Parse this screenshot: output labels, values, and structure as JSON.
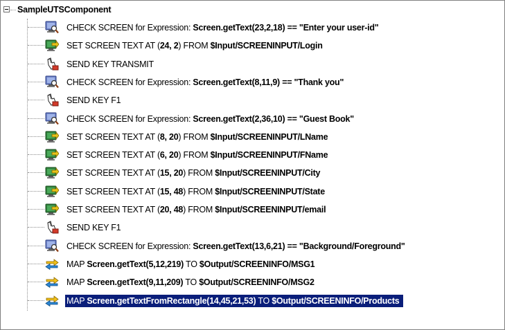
{
  "tree": {
    "root_label": "SampleUTSComponent",
    "items": [
      {
        "icon": "check-screen-icon",
        "prefix": "CHECK SCREEN for Expression: ",
        "bold": "Screen.getText(23,2,18) == \"Enter your user-id\"",
        "suffix": "",
        "mid": "",
        "bold2": ""
      },
      {
        "icon": "set-screen-text-icon",
        "prefix": "SET SCREEN TEXT AT (",
        "bold": "24, 2",
        "mid": ") FROM ",
        "bold2": "$Input/SCREENINPUT/Login",
        "suffix": ""
      },
      {
        "icon": "send-key-icon",
        "prefix": "SEND KEY TRANSMIT",
        "bold": "",
        "mid": "",
        "bold2": "",
        "suffix": ""
      },
      {
        "icon": "check-screen-icon",
        "prefix": "CHECK SCREEN for Expression: ",
        "bold": "Screen.getText(8,11,9) == \"Thank you\"",
        "mid": "",
        "bold2": "",
        "suffix": ""
      },
      {
        "icon": "send-key-icon",
        "prefix": "SEND KEY F1",
        "bold": "",
        "mid": "",
        "bold2": "",
        "suffix": ""
      },
      {
        "icon": "check-screen-icon",
        "prefix": "CHECK SCREEN for Expression: ",
        "bold": "Screen.getText(2,36,10) == \"Guest Book\"",
        "mid": "",
        "bold2": "",
        "suffix": ""
      },
      {
        "icon": "set-screen-text-icon",
        "prefix": "SET SCREEN TEXT AT (",
        "bold": "8, 20",
        "mid": ") FROM ",
        "bold2": "$Input/SCREENINPUT/LName",
        "suffix": ""
      },
      {
        "icon": "set-screen-text-icon",
        "prefix": "SET SCREEN TEXT AT (",
        "bold": "6, 20",
        "mid": ") FROM ",
        "bold2": "$Input/SCREENINPUT/FName",
        "suffix": ""
      },
      {
        "icon": "set-screen-text-icon",
        "prefix": "SET SCREEN TEXT AT (",
        "bold": "15, 20",
        "mid": ") FROM ",
        "bold2": "$Input/SCREENINPUT/City",
        "suffix": ""
      },
      {
        "icon": "set-screen-text-icon",
        "prefix": "SET SCREEN TEXT AT (",
        "bold": "15, 48",
        "mid": ") FROM ",
        "bold2": "$Input/SCREENINPUT/State",
        "suffix": ""
      },
      {
        "icon": "set-screen-text-icon",
        "prefix": "SET SCREEN TEXT AT (",
        "bold": "20, 48",
        "mid": ") FROM ",
        "bold2": "$Input/SCREENINPUT/email",
        "suffix": ""
      },
      {
        "icon": "send-key-icon",
        "prefix": "SEND KEY F1",
        "bold": "",
        "mid": "",
        "bold2": "",
        "suffix": ""
      },
      {
        "icon": "check-screen-icon",
        "prefix": "CHECK SCREEN for Expression: ",
        "bold": "Screen.getText(13,6,21) == \"Background/Foreground\"",
        "mid": "",
        "bold2": "",
        "suffix": ""
      },
      {
        "icon": "map-icon",
        "prefix": "MAP ",
        "bold": "Screen.getText(5,12,219)",
        "mid": " TO ",
        "bold2": "$Output/SCREENINFO/MSG1",
        "suffix": ""
      },
      {
        "icon": "map-icon",
        "prefix": "MAP ",
        "bold": "Screen.getText(9,11,209)",
        "mid": " TO ",
        "bold2": "$Output/SCREENINFO/MSG2",
        "suffix": ""
      },
      {
        "icon": "map-icon",
        "prefix": "MAP ",
        "bold": "Screen.getTextFromRectangle(14,45,21,53)",
        "mid": " TO ",
        "bold2": "$Output/SCREENINFO/Products",
        "suffix": "",
        "selected": true
      }
    ]
  },
  "colors": {
    "selection_bg": "#0a1e7a",
    "selection_fg": "#ffffff",
    "tree_line": "#8c8c8c"
  }
}
